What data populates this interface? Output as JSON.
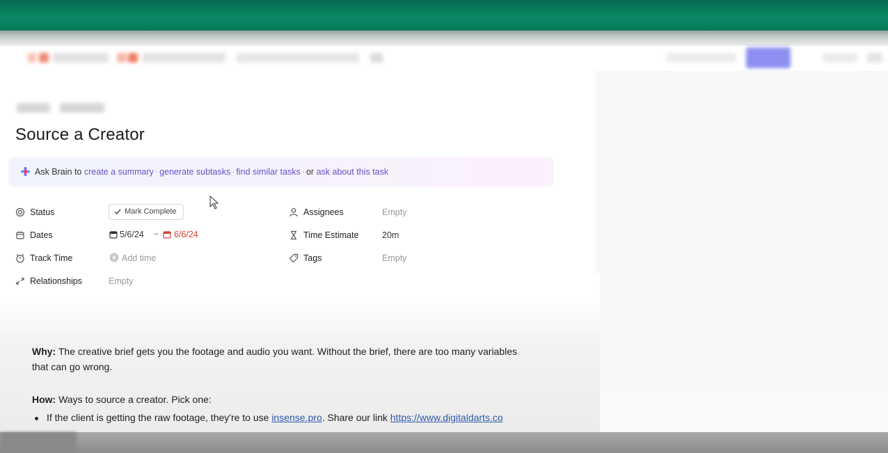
{
  "task": {
    "title": "Source a Creator"
  },
  "brain": {
    "prefix": "Ask Brain to",
    "actions": [
      "create a summary",
      "generate subtasks",
      "find similar tasks"
    ],
    "or_text": "or",
    "last_action": "ask about this task"
  },
  "fields": {
    "status": {
      "label": "Status",
      "button": "Mark Complete"
    },
    "dates": {
      "label": "Dates",
      "start": "5/6/24",
      "arrow": "→",
      "end": "6/6/24"
    },
    "track_time": {
      "label": "Track Time",
      "value": "Add time"
    },
    "relationships": {
      "label": "Relationships",
      "value": "Empty"
    },
    "assignees": {
      "label": "Assignees",
      "value": "Empty"
    },
    "time_estimate": {
      "label": "Time Estimate",
      "value": "20m"
    },
    "tags": {
      "label": "Tags",
      "value": "Empty"
    }
  },
  "description": {
    "why_label": "Why:",
    "why_text": " The creative brief gets you the footage and audio you want. Without the brief, there are too many variables that can go wrong.",
    "how_label": "How:",
    "how_text": " Ways to source a creator. Pick one:",
    "bullet_1_pre": "If the client is getting the raw footage, they're to use ",
    "bullet_1_link": "insense.pro",
    "bullet_1_mid": ". Share our link ",
    "bullet_1_url": "https://www.digitaldarts.co"
  },
  "colors": {
    "accent_link": "#6652c9",
    "date_due": "#d0433a",
    "header_green": "#0a8a65"
  }
}
